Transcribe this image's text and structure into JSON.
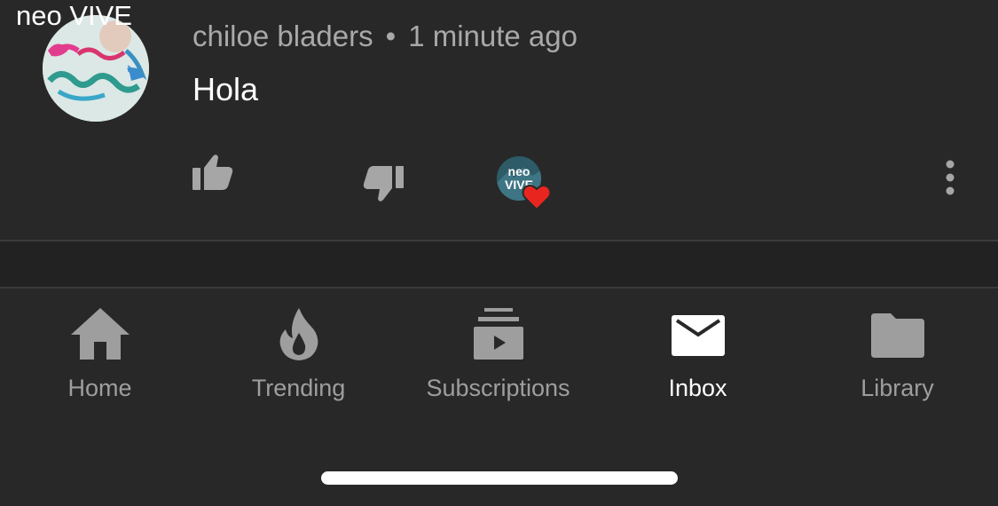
{
  "overlay": {
    "label": "neo VIVE"
  },
  "comment": {
    "author": "chiloe bladers",
    "separator": "•",
    "time": "1 minute ago",
    "text": "Hola",
    "avatar_icon": "channel-avatar",
    "creator_heart": {
      "creator_text": "neo VIVE",
      "heart_color": "#e8251f"
    }
  },
  "actions": {
    "like_icon": "thumb-up-icon",
    "dislike_icon": "thumb-down-icon",
    "more_icon": "more-vert-icon"
  },
  "bottom_nav": {
    "items": [
      {
        "label": "Home",
        "icon": "home-icon",
        "active": false
      },
      {
        "label": "Trending",
        "icon": "flame-icon",
        "active": false
      },
      {
        "label": "Subscriptions",
        "icon": "subscriptions-icon",
        "active": false
      },
      {
        "label": "Inbox",
        "icon": "mail-icon",
        "active": true
      },
      {
        "label": "Library",
        "icon": "folder-icon",
        "active": false
      }
    ]
  },
  "colors": {
    "background": "#282828",
    "muted_text": "#a9a9a9",
    "nav_inactive": "#9e9e9e",
    "active": "#ffffff"
  }
}
